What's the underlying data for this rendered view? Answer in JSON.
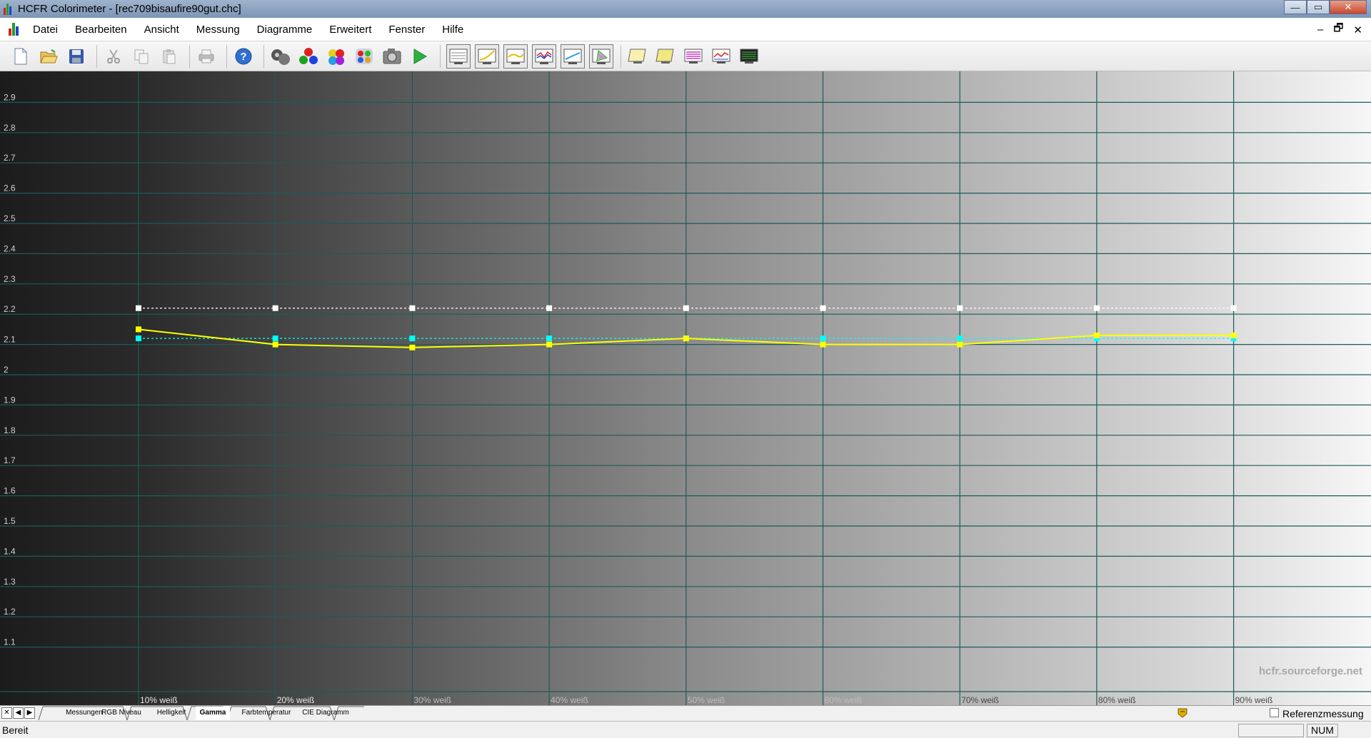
{
  "window": {
    "title": "HCFR Colorimeter - [rec709bisaufire90gut.chc]",
    "buttons": {
      "minimize": "—",
      "maximize": "▭",
      "close": "✕"
    }
  },
  "menu": {
    "items": [
      "Datei",
      "Bearbeiten",
      "Ansicht",
      "Messung",
      "Diagramme",
      "Erweitert",
      "Fenster",
      "Hilfe"
    ],
    "mdi": {
      "minimize": "–",
      "restore": "🗗",
      "close": "✕"
    }
  },
  "toolbar": {
    "icons": [
      "new-file-icon",
      "open-folder-icon",
      "save-icon",
      "cut-icon",
      "copy-icon",
      "paste-icon",
      "print-icon",
      "help-icon",
      "sensor-icon",
      "rgb-dots-icon",
      "color-balls-icon",
      "color-palette-icon",
      "camera-icon",
      "play-icon",
      "graph-window-1-icon",
      "graph-window-2-icon",
      "graph-window-3-icon",
      "graph-window-4-icon",
      "graph-window-5-icon",
      "cie-window-icon",
      "monitor-1-icon",
      "monitor-2-icon",
      "monitor-3-icon",
      "monitor-4-icon",
      "monitor-5-icon"
    ]
  },
  "colors": {
    "measured": "#ffff00",
    "target": "#ffffff",
    "reference": "#00ffff",
    "grid": "#1f5a5a"
  },
  "chart_data": {
    "type": "line",
    "categories": [
      "10% weiß",
      "20% weiß",
      "30% weiß",
      "40% weiß",
      "50% weiß",
      "60% weiß",
      "70% weiß",
      "80% weiß",
      "90% weiß"
    ],
    "series": [
      {
        "values": [
          2.15,
          2.1,
          2.09,
          2.1,
          2.12,
          2.1,
          2.1,
          2.13,
          2.13
        ]
      },
      {
        "values": [
          2.22,
          2.22,
          2.22,
          2.22,
          2.22,
          2.22,
          2.22,
          2.22,
          2.22
        ]
      },
      {
        "values": [
          2.12,
          2.12,
          2.12,
          2.12,
          2.12,
          2.12,
          2.12,
          2.12,
          2.12
        ]
      }
    ],
    "yticks": [
      "2.9",
      "2.8",
      "2.7",
      "2.6",
      "2.5",
      "2.4",
      "2.3",
      "2.2",
      "2.1",
      "2",
      "1.9",
      "1.8",
      "1.7",
      "1.6",
      "1.5",
      "1.4",
      "1.3",
      "1.2",
      "1.1"
    ],
    "ylim": [
      1.0,
      3.0
    ],
    "grid": true,
    "watermark": "hcfr.sourceforge.net"
  },
  "tabs": {
    "nav": [
      "✕",
      "◀",
      "▶"
    ],
    "items": [
      "Messungen",
      "RGB Niveau",
      "Helligkeit",
      "Gamma",
      "Farbtemperatur",
      "CIE Diagramm"
    ],
    "active": "Gamma",
    "reference_label": "Referenzmessung"
  },
  "status": {
    "text": "Bereit",
    "num": "NUM"
  }
}
